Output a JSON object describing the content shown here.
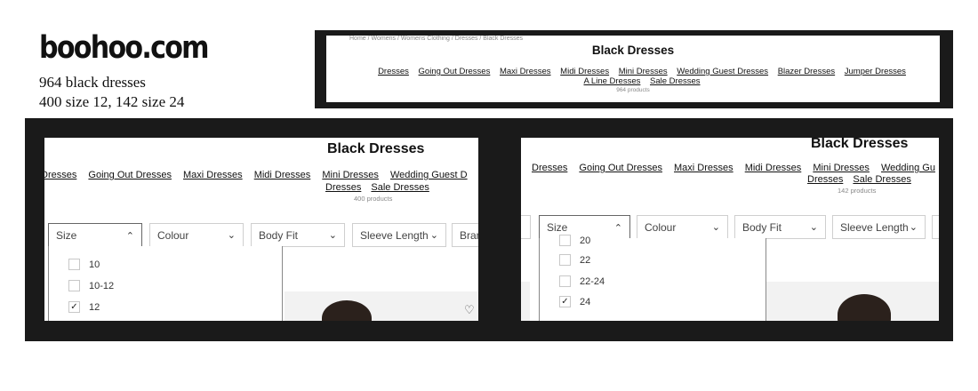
{
  "annotation": {
    "brand": "boohoo.com",
    "stat_line1": "964 black dresses",
    "stat_line2": "400 size 12, 142 size 24"
  },
  "top_shot": {
    "breadcrumb": "Home / Womens / Womens Clothing / Dresses / Black Dresses",
    "title": "Black Dresses",
    "links": [
      "Dresses",
      "Going Out Dresses",
      "Maxi Dresses",
      "Midi Dresses",
      "Mini Dresses",
      "Wedding Guest Dresses",
      "Blazer Dresses",
      "Jumper Dresses",
      "A Line Dresses",
      "Sale Dresses"
    ],
    "count": "964 products"
  },
  "left_shot": {
    "title": "Black Dresses",
    "links_row1": [
      "Dresses",
      "Going Out Dresses",
      "Maxi Dresses",
      "Midi Dresses",
      "Mini Dresses",
      "Wedding Guest D"
    ],
    "links_row2": [
      "Dresses",
      "Sale Dresses"
    ],
    "count": "400 products",
    "filters": [
      "Size",
      "Colour",
      "Body Fit",
      "Sleeve Length",
      "Bran"
    ],
    "options": [
      {
        "label": "10",
        "checked": false
      },
      {
        "label": "10-12",
        "checked": false
      },
      {
        "label": "12",
        "checked": true
      }
    ]
  },
  "right_shot": {
    "title": "Black Dresses",
    "links_row1": [
      "Dresses",
      "Going Out Dresses",
      "Maxi Dresses",
      "Midi Dresses",
      "Mini Dresses",
      "Wedding Gu"
    ],
    "links_row2": [
      "Dresses",
      "Sale Dresses"
    ],
    "count": "142 products",
    "filters": [
      "Size",
      "Colour",
      "Body Fit",
      "Sleeve Length"
    ],
    "options": [
      {
        "label": "20",
        "checked": false
      },
      {
        "label": "22",
        "checked": false
      },
      {
        "label": "22-24",
        "checked": false
      },
      {
        "label": "24",
        "checked": true
      }
    ]
  },
  "icons": {
    "chevron_up": "⌃",
    "chevron_down": "⌄",
    "check": "✓",
    "heart": "♡"
  },
  "colors": {
    "frame": "#1a1a1a",
    "muted": "#888888"
  }
}
